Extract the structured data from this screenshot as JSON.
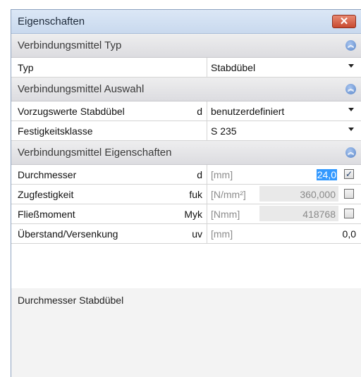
{
  "window": {
    "title": "Eigenschaften",
    "close_glyph": "✕"
  },
  "sections": {
    "typ": {
      "title": "Verbindungsmittel Typ"
    },
    "auswahl": {
      "title": "Verbindungsmittel Auswahl"
    },
    "eigenschaften": {
      "title": "Verbindungsmittel Eigenschaften"
    }
  },
  "rows": {
    "typ": {
      "label": "Typ",
      "value": "Stabdübel"
    },
    "vorzugswerte": {
      "label": "Vorzugswerte Stabdübel",
      "symbol": "d",
      "value": "benutzerdefiniert"
    },
    "festigkeit": {
      "label": "Festigkeitsklasse",
      "value": "S 235"
    },
    "durchmesser": {
      "label": "Durchmesser",
      "symbol": "d",
      "unit": "[mm]",
      "value": "24,0",
      "checked": true
    },
    "zugfestigkeit": {
      "label": "Zugfestigkeit",
      "symbol": "fuk",
      "unit": "[N/mm²]",
      "value": "360,000",
      "checked": false
    },
    "fliessmoment": {
      "label": "Fließmoment",
      "symbol": "Myk",
      "unit": "[Nmm]",
      "value": "418768",
      "checked": false
    },
    "ueberstand": {
      "label": "Überstand/Versenkung",
      "symbol": "uv",
      "unit": "[mm]",
      "value": "0,0"
    }
  },
  "description": {
    "text": "Durchmesser Stabdübel"
  },
  "icons": {
    "collapse": "double-chevron-up-icon",
    "dropdown": "dropdown-arrow-icon",
    "check": "✓"
  },
  "colors": {
    "accent": "#3399ff",
    "section_icon": "#5b87c9",
    "close": "#c84a30"
  }
}
